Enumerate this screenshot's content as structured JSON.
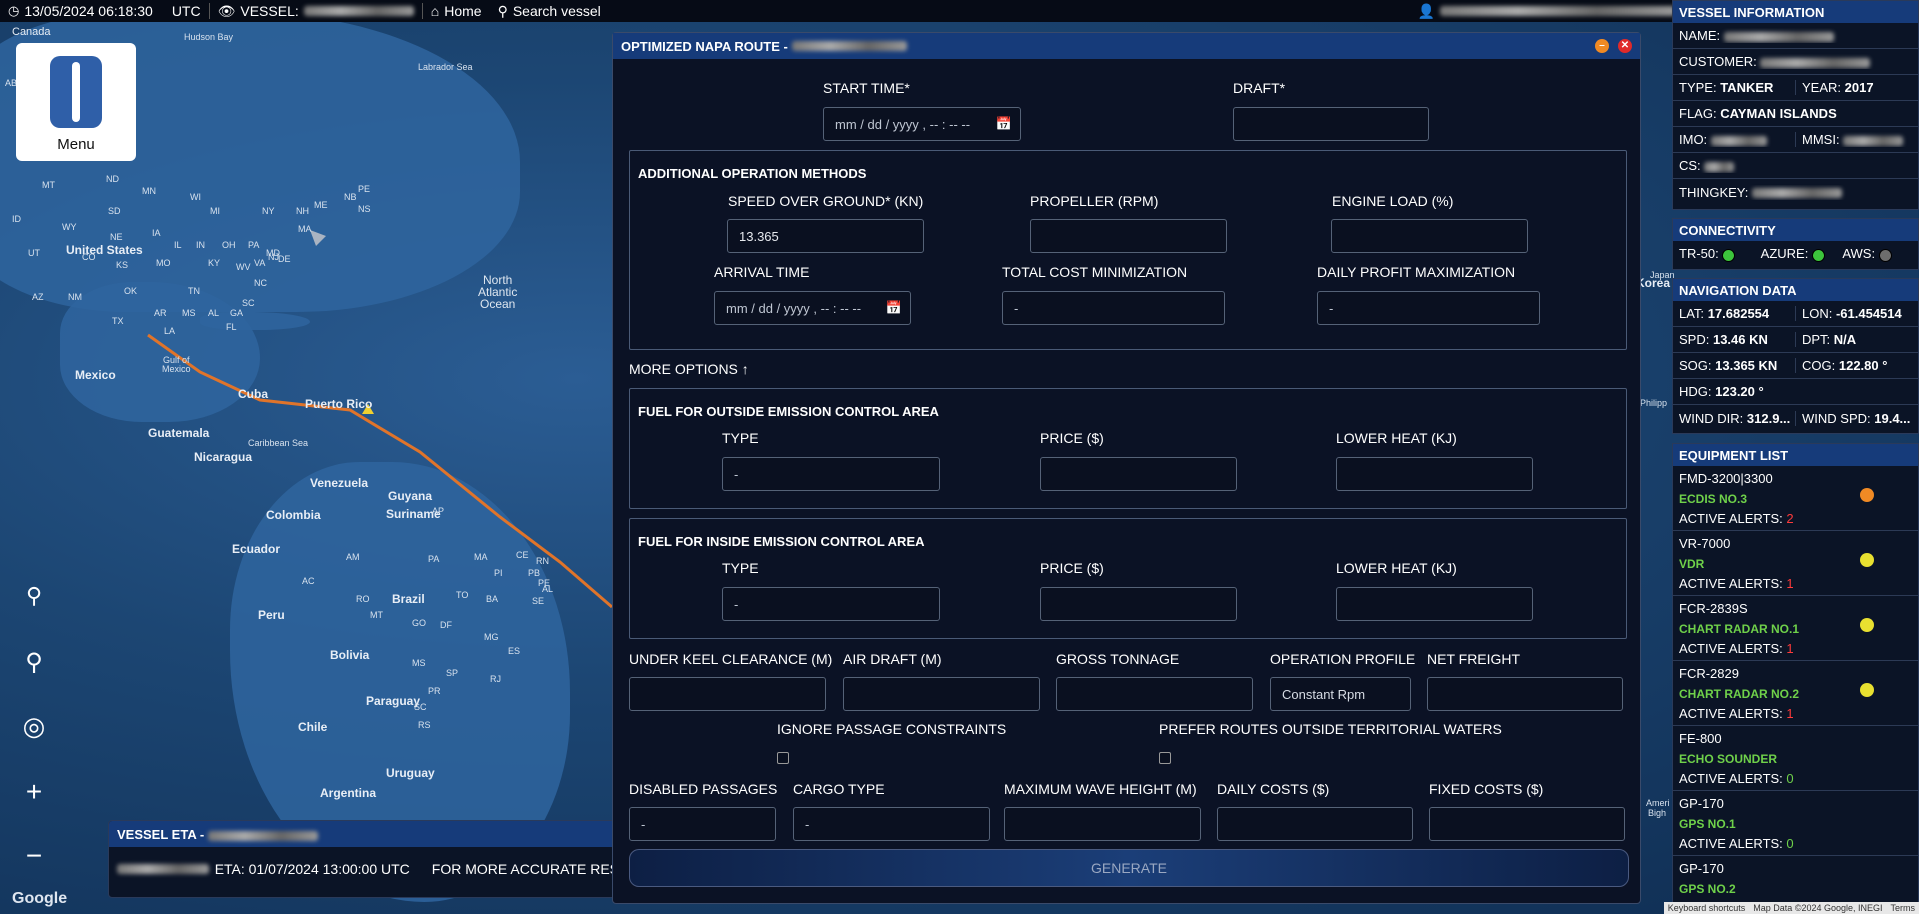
{
  "topbar": {
    "datetime": "13/05/2024 06:18:30",
    "timezone": "UTC",
    "vessel_label": "VESSEL:",
    "home": "Home",
    "search": "Search vessel"
  },
  "menu": {
    "label": "Menu"
  },
  "map": {
    "labels": {
      "canada": "Canada",
      "hudson_bay": "Hudson Bay",
      "labrador_sea": "Labrador Sea",
      "united_states": "United States",
      "mexico": "Mexico",
      "gulf": "Gulf of\nMexico",
      "cuba": "Cuba",
      "puerto_rico": "Puerto Rico",
      "guatemala": "Guatemala",
      "caribbean": "Caribbean Sea",
      "nicaragua": "Nicaragua",
      "venezuela": "Venezuela",
      "guyana": "Guyana",
      "suriname": "Suriname",
      "colombia": "Colombia",
      "ecuador": "Ecuador",
      "brazil": "Brazil",
      "peru": "Peru",
      "bolivia": "Bolivia",
      "paraguay": "Paraguay",
      "chile": "Chile",
      "uruguay": "Uruguay",
      "argentina": "Argentina",
      "north_atlantic": "North\nAtlantic\nOcean",
      "japan": "Japan",
      "korea": "Korea",
      "philipp": "Philipp",
      "bigh": "Bigh",
      "ameri": "Ameri",
      "ab": "AB"
    },
    "states": [
      "MT",
      "ND",
      "MN",
      "SD",
      "WI",
      "MI",
      "NY",
      "NH",
      "ME",
      "NB",
      "PE",
      "NS",
      "MA",
      "ID",
      "WY",
      "NE",
      "IA",
      "IL",
      "IN",
      "OH",
      "PA",
      "NJ",
      "UT",
      "CO",
      "KS",
      "MO",
      "KY",
      "WV",
      "VA",
      "MD",
      "DE",
      "AZ",
      "NM",
      "OK",
      "TN",
      "NC",
      "SC",
      "AR",
      "MS",
      "AL",
      "GA",
      "TX",
      "LA",
      "FL"
    ],
    "br_states": [
      "AP",
      "AM",
      "PA",
      "MA",
      "CE",
      "RN",
      "PB",
      "PE",
      "AL",
      "SE",
      "PI",
      "TO",
      "AC",
      "RO",
      "BA",
      "MT",
      "GO",
      "DF",
      "MG",
      "ES",
      "MS",
      "SP",
      "RJ",
      "PR",
      "SC",
      "RS"
    ],
    "google": "Google",
    "attribution": [
      "Keyboard shortcuts",
      "Map Data ©2024 Google, INEGI",
      "Terms"
    ]
  },
  "eta": {
    "title": "VESSEL ETA -",
    "eta_text": "ETA: 01/07/2024 13:00:00 UTC",
    "more": "FOR MORE ACCURATE RES"
  },
  "route": {
    "title": "OPTIMIZED NAPA ROUTE -",
    "start_time_label": "START TIME*",
    "start_time_placeholder": "mm / dd / yyyy , -- : --  --",
    "draft_label": "DRAFT*",
    "additional_title": "ADDITIONAL OPERATION METHODS",
    "sog_label": "SPEED OVER GROUND* (KN)",
    "sog_value": "13.365",
    "propeller_label": "PROPELLER (RPM)",
    "engine_label": "ENGINE LOAD (%)",
    "arrival_label": "ARRIVAL TIME",
    "arrival_placeholder": "mm / dd / yyyy , -- : --  --",
    "cost_min_label": "TOTAL COST MINIMIZATION",
    "cost_min_value": "-",
    "profit_max_label": "DAILY PROFIT MAXIMIZATION",
    "profit_max_value": "-",
    "more_options": "MORE OPTIONS",
    "fuel_outside_title": "FUEL FOR OUTSIDE EMISSION CONTROL AREA",
    "fuel_inside_title": "FUEL FOR INSIDE EMISSION CONTROL AREA",
    "type_label": "TYPE",
    "price_label": "PRICE ($)",
    "lower_heat_label": "LOWER HEAT (KJ)",
    "dash": "-",
    "ukc_label": "UNDER KEEL CLEARANCE (M)",
    "air_draft_label": "AIR DRAFT (M)",
    "gross_label": "GROSS TONNAGE",
    "op_profile_label": "OPERATION PROFILE",
    "op_profile_value": "Constant Rpm",
    "net_freight_label": "NET FREIGHT",
    "ignore_label": "IGNORE PASSAGE CONSTRAINTS",
    "prefer_label": "PREFER ROUTES OUTSIDE TERRITORIAL WATERS",
    "disabled_label": "DISABLED PASSAGES",
    "cargo_label": "CARGO TYPE",
    "wave_label": "MAXIMUM WAVE HEIGHT (M)",
    "daily_costs_label": "DAILY COSTS ($)",
    "fixed_costs_label": "FIXED COSTS ($)",
    "generate": "GENERATE"
  },
  "vessel_info": {
    "title": "VESSEL INFORMATION",
    "name": "NAME:",
    "customer": "CUSTOMER:",
    "type_k": "TYPE:",
    "type_v": "TANKER",
    "year_k": "YEAR:",
    "year_v": "2017",
    "flag_k": "FLAG:",
    "flag_v": "CAYMAN ISLANDS",
    "imo": "IMO:",
    "mmsi": "MMSI:",
    "cs": "CS:",
    "thingkey": "THINGKEY:"
  },
  "connectivity": {
    "title": "CONNECTIVITY",
    "tr50": "TR-50:",
    "azure": "AZURE:",
    "aws": "AWS:",
    "colors": {
      "tr50": "#3cc43c",
      "azure": "#3cc43c",
      "aws": "#6d6d6d"
    }
  },
  "navigation": {
    "title": "NAVIGATION DATA",
    "lat_k": "LAT:",
    "lat_v": "17.682554",
    "lon_k": "LON:",
    "lon_v": "-61.454514",
    "spd_k": "SPD:",
    "spd_v": "13.46 KN",
    "dpt_k": "DPT:",
    "dpt_v": "N/A",
    "sog_k": "SOG:",
    "sog_v": "13.365 KN",
    "cog_k": "COG:",
    "cog_v": "122.80 °",
    "hdg_k": "HDG:",
    "hdg_v": "123.20 °",
    "wdir_k": "WIND DIR:",
    "wdir_v": "312.9...",
    "wspd_k": "WIND SPD:",
    "wspd_v": "19.4..."
  },
  "equipment": {
    "title": "EQUIPMENT LIST",
    "alerts_label": "ACTIVE ALERTS:",
    "items": [
      {
        "model": "FMD-3200|3300",
        "name": "ECDIS NO.3",
        "alerts": "2",
        "status": "#f08a24"
      },
      {
        "model": "VR-7000",
        "name": "VDR",
        "alerts": "1",
        "status": "#e8e030"
      },
      {
        "model": "FCR-2839S",
        "name": "CHART RADAR NO.1",
        "alerts": "1",
        "status": "#e8e030"
      },
      {
        "model": "FCR-2829",
        "name": "CHART RADAR NO.2",
        "alerts": "1",
        "status": "#e8e030"
      },
      {
        "model": "FE-800",
        "name": "ECHO SOUNDER",
        "alerts": "0",
        "status": ""
      },
      {
        "model": "GP-170",
        "name": "GPS NO.1",
        "alerts": "0",
        "status": ""
      },
      {
        "model": "GP-170",
        "name": "GPS NO.2",
        "alerts": "",
        "status": ""
      }
    ]
  }
}
